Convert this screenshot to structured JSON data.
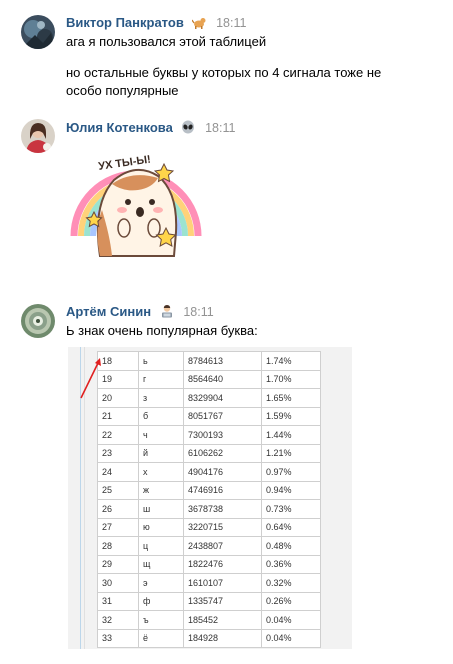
{
  "messages": [
    {
      "author": "Виктор Панкратов",
      "time": "18:11",
      "emoji": "dog-emoji",
      "lines": [
        "ага я пользовался этой таблицей",
        "но остальные буквы у которых по 4 сигнала тоже не особо популярные"
      ]
    },
    {
      "author": "Юлия Котенкова",
      "time": "18:11",
      "emoji": "alien-emoji",
      "sticker_text": "УХ ТЫ-Ы!"
    },
    {
      "author": "Артём Синин",
      "time": "18:11",
      "emoji": "technologist-emoji",
      "lines": [
        "Ь знак очень популярная буква:"
      ]
    }
  ],
  "letter_table": {
    "rows": [
      [
        "18",
        "ь",
        "8784613",
        "1.74%"
      ],
      [
        "19",
        "г",
        "8564640",
        "1.70%"
      ],
      [
        "20",
        "з",
        "8329904",
        "1.65%"
      ],
      [
        "21",
        "б",
        "8051767",
        "1.59%"
      ],
      [
        "22",
        "ч",
        "7300193",
        "1.44%"
      ],
      [
        "23",
        "й",
        "6106262",
        "1.21%"
      ],
      [
        "24",
        "х",
        "4904176",
        "0.97%"
      ],
      [
        "25",
        "ж",
        "4746916",
        "0.94%"
      ],
      [
        "26",
        "ш",
        "3678738",
        "0.73%"
      ],
      [
        "27",
        "ю",
        "3220715",
        "0.64%"
      ],
      [
        "28",
        "ц",
        "2438807",
        "0.48%"
      ],
      [
        "29",
        "щ",
        "1822476",
        "0.36%"
      ],
      [
        "30",
        "э",
        "1610107",
        "0.32%"
      ],
      [
        "31",
        "ф",
        "1335747",
        "0.26%"
      ],
      [
        "32",
        "ъ",
        "185452",
        "0.04%"
      ],
      [
        "33",
        "ё",
        "184928",
        "0.04%"
      ]
    ]
  },
  "colors": {
    "name": "#2a5885",
    "time": "#939393",
    "arrow": "#e02020"
  }
}
